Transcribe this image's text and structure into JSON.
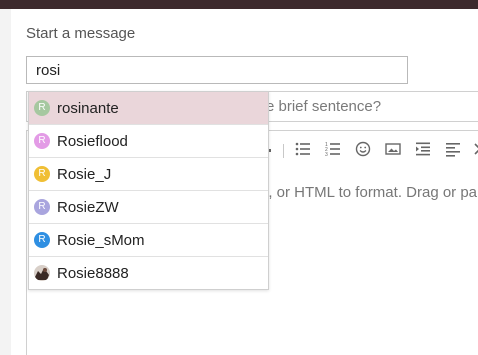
{
  "compose": {
    "title": "Start a message",
    "to_value": "rosi",
    "subject_placeholder_visible": "e brief sentence?",
    "editor_hint_visible": "e, or HTML to format. Drag or pa"
  },
  "suggestions": [
    {
      "initial": "R",
      "name": "rosinante",
      "color": "#a6c8a0",
      "highlighted": true
    },
    {
      "initial": "R",
      "name": "Rosieflood",
      "color": "#e39be6",
      "highlighted": false
    },
    {
      "initial": "R",
      "name": "Rosie_J",
      "color": "#f0bf35",
      "highlighted": false
    },
    {
      "initial": "R",
      "name": "RosieZW",
      "color": "#a9a5de",
      "highlighted": false
    },
    {
      "initial": "R",
      "name": "Rosie_sMom",
      "color": "#2f8fe2",
      "highlighted": false
    },
    {
      "initial": "",
      "name": "Rosie8888",
      "color": "#3a2a25",
      "highlighted": false,
      "photo": true
    }
  ],
  "toolbar_icons": [
    "bullet-list-icon",
    "numbered-list-icon",
    "emoji-icon",
    "image-icon",
    "indent-icon",
    "align-left-icon",
    "more-icon"
  ],
  "colors": {
    "topbar": "#3d2a2d",
    "highlight": "#ead6da"
  }
}
